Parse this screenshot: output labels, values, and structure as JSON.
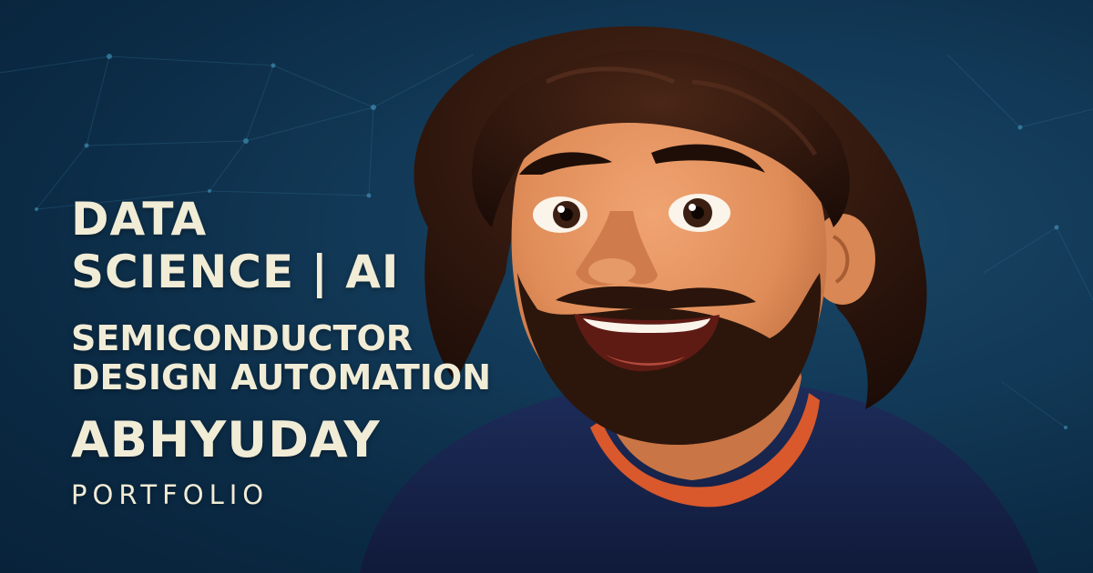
{
  "headline": {
    "line1": "DATA",
    "line2": "SCIENCE | AI",
    "line3": "SEMICONDUCTOR",
    "line4": "DESIGN AUTOMATION"
  },
  "name": "ABHYUDAY",
  "subtitle": "PORTFOLIO",
  "colors": {
    "background": "#0b2a44",
    "text": "#f1ecd6",
    "hair": "#2a140c",
    "skin": "#e59560",
    "sweater": "#16224a",
    "collar": "#d9582c"
  },
  "illustration": {
    "icon": "cartoon-portrait-icon",
    "background_icon": "network-pattern-icon"
  }
}
